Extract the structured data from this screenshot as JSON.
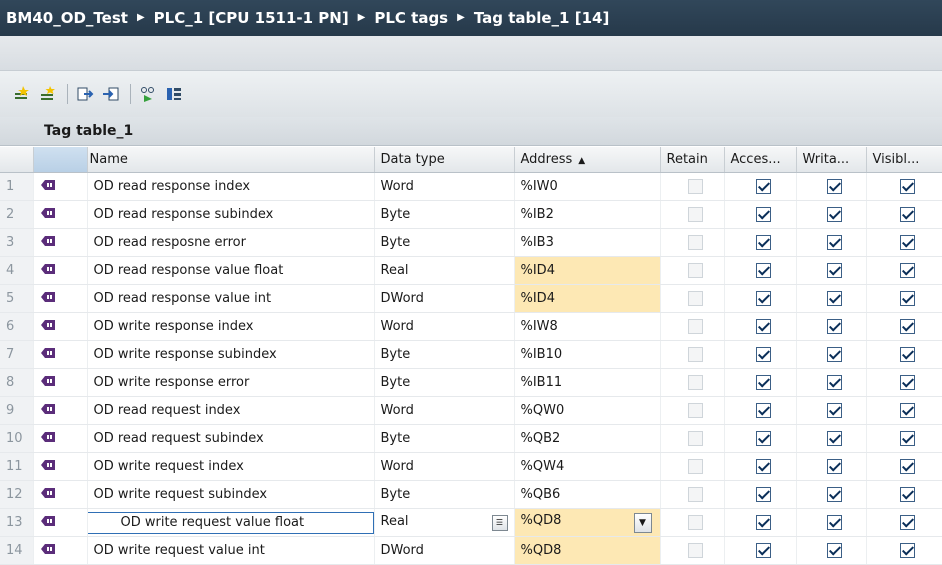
{
  "breadcrumb": {
    "items": [
      "BM40_OD_Test",
      "PLC_1 [CPU 1511-1 PN]",
      "PLC tags",
      "Tag table_1 [14]"
    ],
    "separator": "▶"
  },
  "toolbar": {
    "buttons": [
      "add-row-icon",
      "insert-row-icon",
      "export-icon",
      "import-icon",
      "monitor-icon",
      "overview-icon"
    ]
  },
  "table_title": "Tag table_1",
  "columns": {
    "name": "Name",
    "data_type": "Data type",
    "address": "Address",
    "retain": "Retain",
    "access": "Acces...",
    "write": "Writa...",
    "visible": "Visibl..."
  },
  "sort": {
    "column": "address",
    "direction": "ascending"
  },
  "rows": [
    {
      "num": "1",
      "name": "OD read response index",
      "type": "Word",
      "address": "%IW0",
      "retain": false,
      "access": true,
      "write": true,
      "visible": true,
      "highlight": false
    },
    {
      "num": "2",
      "name": "OD read response subindex",
      "type": "Byte",
      "address": "%IB2",
      "retain": false,
      "access": true,
      "write": true,
      "visible": true,
      "highlight": false
    },
    {
      "num": "3",
      "name": "OD read resposne error",
      "type": "Byte",
      "address": "%IB3",
      "retain": false,
      "access": true,
      "write": true,
      "visible": true,
      "highlight": false
    },
    {
      "num": "4",
      "name": "OD read response value float",
      "type": "Real",
      "address": "%ID4",
      "retain": false,
      "access": true,
      "write": true,
      "visible": true,
      "highlight": true
    },
    {
      "num": "5",
      "name": "OD read response value int",
      "type": "DWord",
      "address": "%ID4",
      "retain": false,
      "access": true,
      "write": true,
      "visible": true,
      "highlight": true
    },
    {
      "num": "6",
      "name": "OD write response index",
      "type": "Word",
      "address": "%IW8",
      "retain": false,
      "access": true,
      "write": true,
      "visible": true,
      "highlight": false
    },
    {
      "num": "7",
      "name": "OD write response subindex",
      "type": "Byte",
      "address": "%IB10",
      "retain": false,
      "access": true,
      "write": true,
      "visible": true,
      "highlight": false
    },
    {
      "num": "8",
      "name": "OD write response error",
      "type": "Byte",
      "address": "%IB11",
      "retain": false,
      "access": true,
      "write": true,
      "visible": true,
      "highlight": false
    },
    {
      "num": "9",
      "name": "OD read request index",
      "type": "Word",
      "address": "%QW0",
      "retain": false,
      "access": true,
      "write": true,
      "visible": true,
      "highlight": false
    },
    {
      "num": "10",
      "name": "OD read request subindex",
      "type": "Byte",
      "address": "%QB2",
      "retain": false,
      "access": true,
      "write": true,
      "visible": true,
      "highlight": false
    },
    {
      "num": "11",
      "name": "OD write request index",
      "type": "Word",
      "address": "%QW4",
      "retain": false,
      "access": true,
      "write": true,
      "visible": true,
      "highlight": false
    },
    {
      "num": "12",
      "name": "OD write request subindex",
      "type": "Byte",
      "address": "%QB6",
      "retain": false,
      "access": true,
      "write": true,
      "visible": true,
      "highlight": false
    },
    {
      "num": "13",
      "name": "OD write request value float",
      "type": "Real",
      "address": "%QD8",
      "retain": false,
      "access": true,
      "write": true,
      "visible": true,
      "highlight": true,
      "editing": true
    },
    {
      "num": "14",
      "name": "OD write request value int",
      "type": "DWord",
      "address": "%QD8",
      "retain": false,
      "access": true,
      "write": true,
      "visible": true,
      "highlight": true
    }
  ],
  "colors": {
    "highlight": "#fde8b4",
    "titlebar": "#2c4154",
    "tag_icon": "#5b2d7a"
  }
}
